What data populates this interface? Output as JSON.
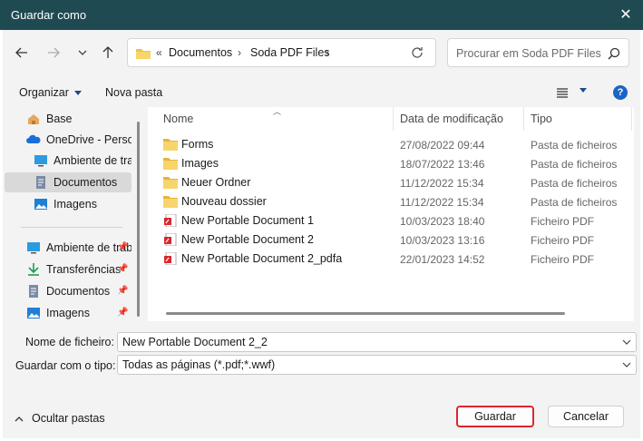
{
  "window": {
    "title": "Guardar como",
    "close_icon": "close-icon"
  },
  "address": {
    "crumbs": [
      "Documentos",
      "Soda PDF Files"
    ],
    "overflow": "«"
  },
  "search": {
    "placeholder": "Procurar em Soda PDF Files"
  },
  "toolbar": {
    "organize": "Organizar",
    "new_folder": "Nova pasta"
  },
  "sidebar": {
    "items": [
      {
        "label": "Base",
        "icon": "home-icon"
      },
      {
        "label": "OneDrive - Personal",
        "icon": "cloud-icon"
      },
      {
        "label": "Ambiente de trabalho",
        "icon": "desktop-icon"
      },
      {
        "label": "Documentos",
        "icon": "document-icon"
      },
      {
        "label": "Imagens",
        "icon": "image-icon"
      }
    ],
    "quick_access": [
      {
        "label": "Ambiente de trabalho",
        "icon": "desktop-icon"
      },
      {
        "label": "Transferências",
        "icon": "download-icon"
      },
      {
        "label": "Documentos",
        "icon": "document-icon"
      },
      {
        "label": "Imagens",
        "icon": "image-icon"
      }
    ]
  },
  "columns": {
    "name": "Nome",
    "date": "Data de modificação",
    "type": "Tipo"
  },
  "files": [
    {
      "name": "Forms",
      "date": "27/08/2022 09:44",
      "type": "Pasta de ficheiros",
      "icon": "folder-icon"
    },
    {
      "name": "Images",
      "date": "18/07/2022 13:46",
      "type": "Pasta de ficheiros",
      "icon": "folder-icon"
    },
    {
      "name": "Neuer Ordner",
      "date": "11/12/2022 15:34",
      "type": "Pasta de ficheiros",
      "icon": "folder-icon"
    },
    {
      "name": "Nouveau dossier",
      "date": "11/12/2022 15:34",
      "type": "Pasta de ficheiros",
      "icon": "folder-icon"
    },
    {
      "name": "New Portable Document 1",
      "date": "10/03/2023 18:40",
      "type": "Ficheiro PDF",
      "icon": "pdf-file-icon"
    },
    {
      "name": "New Portable Document 2",
      "date": "10/03/2023 13:16",
      "type": "Ficheiro PDF",
      "icon": "pdf-file-icon"
    },
    {
      "name": "New Portable Document 2_pdfa",
      "date": "22/01/2023 14:52",
      "type": "Ficheiro PDF",
      "icon": "pdf-file-icon"
    }
  ],
  "form": {
    "filename_label": "Nome de ficheiro:",
    "filename_value": "New Portable Document 2_2",
    "type_label": "Guardar com o tipo:",
    "type_value": "Todas as páginas (*.pdf;*.wwf)"
  },
  "footer": {
    "hide_folders": "Ocultar pastas",
    "save": "Guardar",
    "cancel": "Cancelar"
  },
  "colors": {
    "titlebar": "#1f4a52",
    "highlight": "#d9282f",
    "folder": "#f0c24b",
    "pdf": "#d9282f"
  }
}
